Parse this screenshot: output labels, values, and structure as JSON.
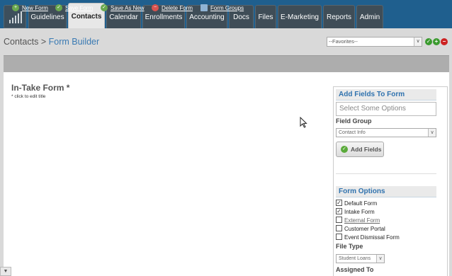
{
  "nav": {
    "tabs": [
      "Guidelines",
      "Contacts",
      "Calendar",
      "Enrollments",
      "Accounting",
      "Docs",
      "Files",
      "E-Marketing",
      "Reports",
      "Admin"
    ],
    "active": "Contacts"
  },
  "breadcrumb": {
    "parent": "Contacts",
    "separator": ">",
    "current": "Form Builder"
  },
  "favorites": {
    "selected": "--Favorites--"
  },
  "toolbar": {
    "new_form": "New Form",
    "save_form": "Save Form",
    "save_as_new": "Save As New",
    "delete_form": "Delete Form",
    "form_groups": "Form Groups"
  },
  "form": {
    "title": "In-Take Form *",
    "hint": "* click to edit title"
  },
  "add_fields": {
    "heading": "Add Fields To Form",
    "placeholder": "Select Some Options",
    "field_group_label": "Field Group",
    "field_group_value": "Contact Info",
    "add_button": "Add Fields"
  },
  "form_options": {
    "heading": "Form Options",
    "checks": [
      {
        "label": "Default Form",
        "checked": true
      },
      {
        "label": "Intake Form",
        "checked": true
      },
      {
        "label": "External Form",
        "checked": false
      },
      {
        "label": "Customer Portal",
        "checked": false
      },
      {
        "label": "Event Dismissal Form",
        "checked": false
      }
    ],
    "file_type_label": "File Type",
    "file_type_value": "Student Loans",
    "assigned_to_label": "Assigned To"
  },
  "colors": {
    "nav_bg": "#1f5f8e",
    "accent": "#2f72ae",
    "toolbar": "#adadad"
  }
}
